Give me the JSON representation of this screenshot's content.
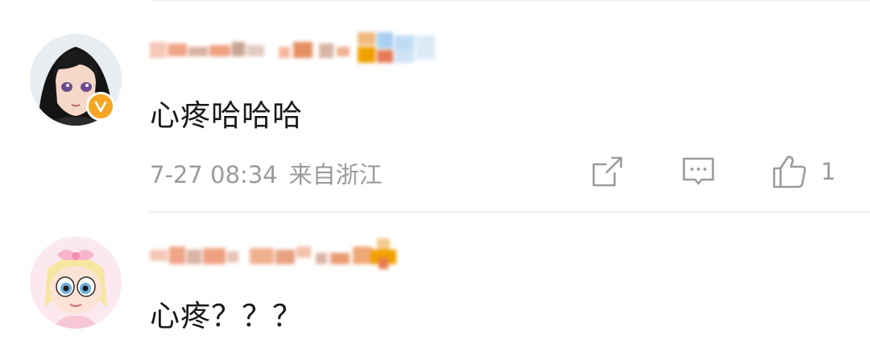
{
  "comments": [
    {
      "text": "心疼哈哈哈",
      "time": "7-27 08:34",
      "source": "来自浙江",
      "like_count": "1",
      "verified": true,
      "avatar_icon": "anime-girl-avatar",
      "username_obscured": true
    },
    {
      "text": "心疼？？？",
      "avatar_icon": "cartoon-girl-bow-avatar",
      "username_obscured": true
    }
  ],
  "icons": {
    "share": "share-icon",
    "reply": "comment-icon",
    "like": "thumbs-up-icon",
    "verified": "verified-badge-icon"
  },
  "colors": {
    "text": "#1a1a1a",
    "meta": "#9b9b9b",
    "verified_badge": "#f5a623",
    "divider": "#ededed"
  }
}
